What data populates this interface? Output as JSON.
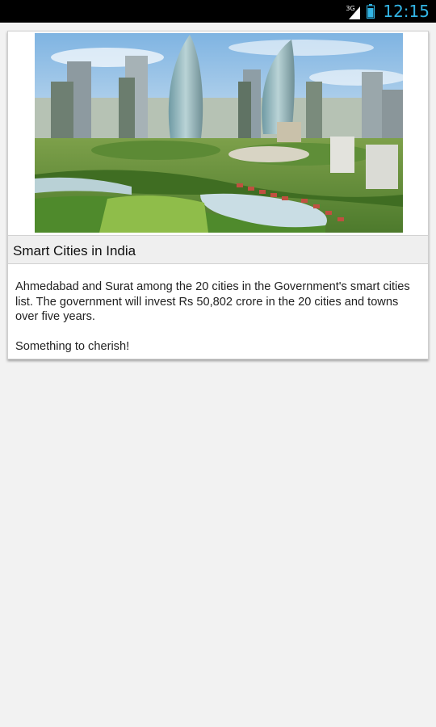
{
  "status_bar": {
    "network_type": "3G",
    "signal_icon": "signal-icon",
    "battery_icon": "battery-icon",
    "time": "12:15",
    "accent_color": "#33b5e5"
  },
  "article": {
    "image_icon": "smart-city-skyline-image",
    "title": "Smart Cities in India",
    "paragraphs": [
      "Ahmedabad and Surat among the 20 cities in the Government's smart cities list. The government will invest Rs 50,802 crore in the 20 cities and towns over five years.",
      "Something to cherish!"
    ]
  }
}
